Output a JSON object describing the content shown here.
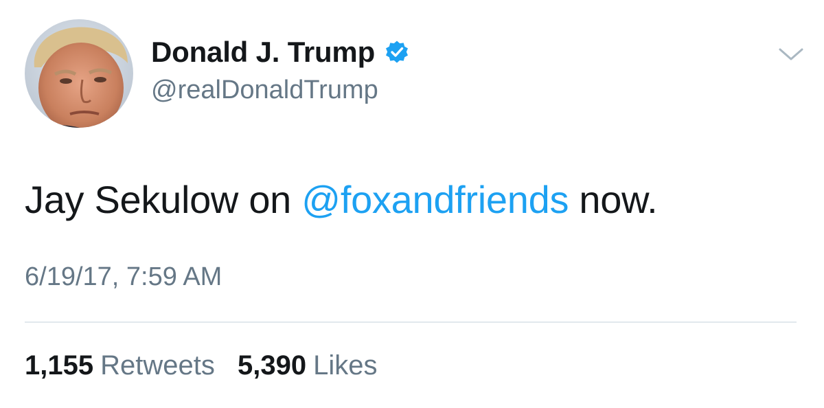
{
  "author": {
    "display_name": "Donald J. Trump",
    "handle": "@realDonaldTrump",
    "verified": true,
    "avatar_icon": "profile-photo",
    "badge_icon": "verified-badge-icon"
  },
  "tweet": {
    "text_before": "Jay Sekulow on ",
    "mention": "@foxandfriends",
    "text_after": " now.",
    "timestamp": "6/19/17, 7:59 AM"
  },
  "stats": {
    "retweets_count": "1,155",
    "retweets_label": "Retweets",
    "likes_count": "5,390",
    "likes_label": "Likes"
  },
  "menu": {
    "icon": "chevron-down-icon"
  },
  "colors": {
    "link": "#1da1f2",
    "badge": "#1da1f2",
    "secondary_text": "#657786",
    "primary_text": "#14171a",
    "divider": "#e1e8ed"
  }
}
